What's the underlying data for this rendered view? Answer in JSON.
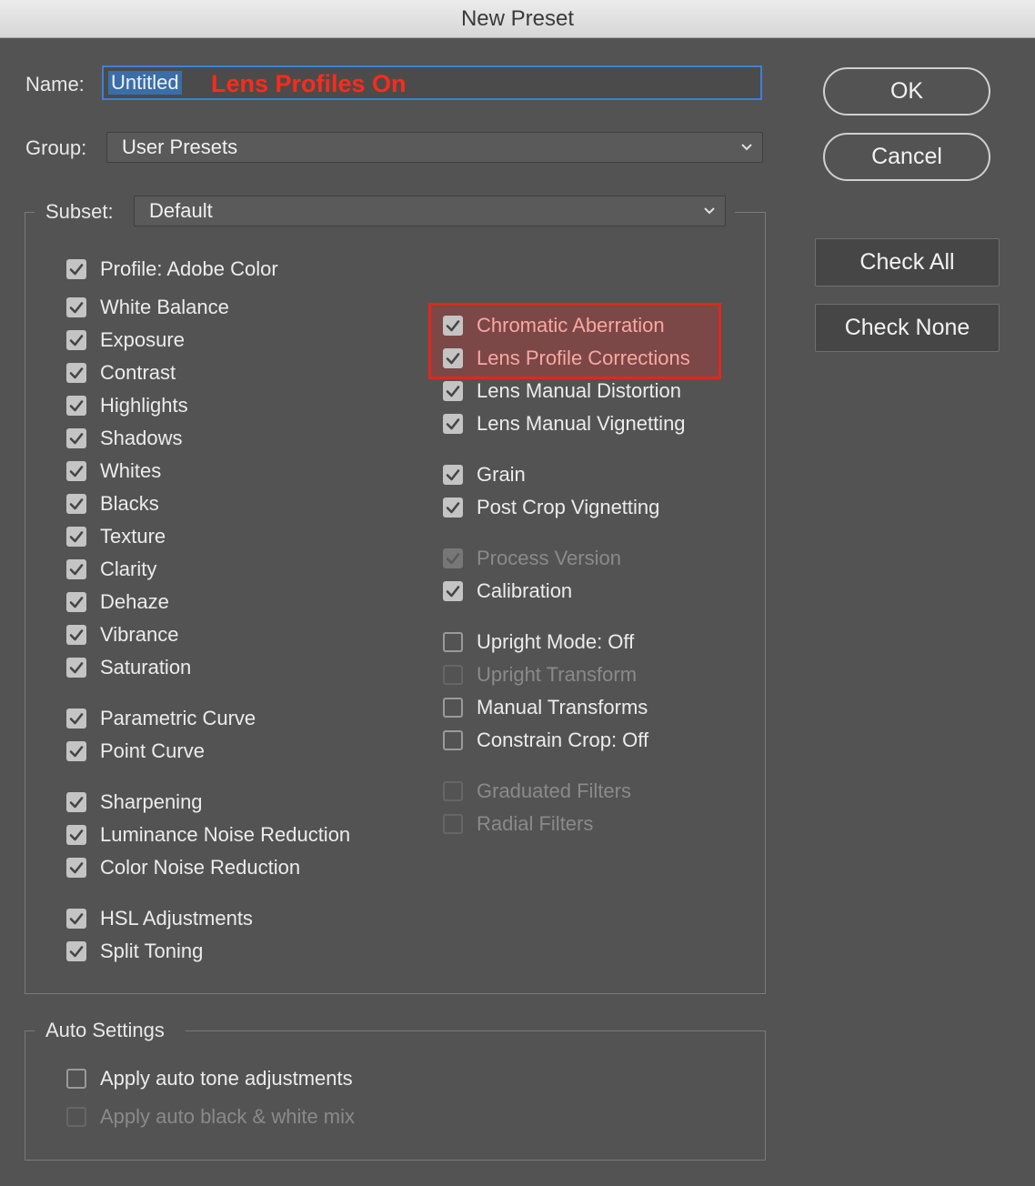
{
  "window": {
    "title": "New Preset"
  },
  "name_field": {
    "label": "Name:",
    "selected_value": "Untitled",
    "annotation": "Lens Profiles On"
  },
  "group": {
    "label": "Group:",
    "value": "User Presets"
  },
  "subset": {
    "label": "Subset:",
    "value": "Default"
  },
  "buttons": {
    "ok": "OK",
    "cancel": "Cancel",
    "check_all": "Check All",
    "check_none": "Check None"
  },
  "left_items": [
    {
      "label": "Profile: Adobe Color",
      "checked": true,
      "enabled": true
    },
    {
      "label": "White Balance",
      "checked": true,
      "enabled": true
    },
    {
      "label": "Exposure",
      "checked": true,
      "enabled": true
    },
    {
      "label": "Contrast",
      "checked": true,
      "enabled": true
    },
    {
      "label": "Highlights",
      "checked": true,
      "enabled": true
    },
    {
      "label": "Shadows",
      "checked": true,
      "enabled": true
    },
    {
      "label": "Whites",
      "checked": true,
      "enabled": true
    },
    {
      "label": "Blacks",
      "checked": true,
      "enabled": true
    },
    {
      "label": "Texture",
      "checked": true,
      "enabled": true
    },
    {
      "label": "Clarity",
      "checked": true,
      "enabled": true
    },
    {
      "label": "Dehaze",
      "checked": true,
      "enabled": true
    },
    {
      "label": "Vibrance",
      "checked": true,
      "enabled": true
    },
    {
      "label": "Saturation",
      "checked": true,
      "enabled": true
    },
    {
      "label": "Parametric Curve",
      "checked": true,
      "enabled": true
    },
    {
      "label": "Point Curve",
      "checked": true,
      "enabled": true
    },
    {
      "label": "Sharpening",
      "checked": true,
      "enabled": true
    },
    {
      "label": "Luminance Noise Reduction",
      "checked": true,
      "enabled": true
    },
    {
      "label": "Color Noise Reduction",
      "checked": true,
      "enabled": true
    },
    {
      "label": "HSL Adjustments",
      "checked": true,
      "enabled": true
    },
    {
      "label": "Split Toning",
      "checked": true,
      "enabled": true
    }
  ],
  "right_items": [
    {
      "label": "Chromatic Aberration",
      "checked": true,
      "enabled": true,
      "highlighted": true
    },
    {
      "label": "Lens Profile Corrections",
      "checked": true,
      "enabled": true,
      "highlighted": true
    },
    {
      "label": "Lens Manual Distortion",
      "checked": true,
      "enabled": true
    },
    {
      "label": "Lens Manual Vignetting",
      "checked": true,
      "enabled": true
    },
    {
      "label": "Grain",
      "checked": true,
      "enabled": true
    },
    {
      "label": "Post Crop Vignetting",
      "checked": true,
      "enabled": true
    },
    {
      "label": "Process Version",
      "checked": true,
      "enabled": false
    },
    {
      "label": "Calibration",
      "checked": true,
      "enabled": true
    },
    {
      "label": "Upright Mode: Off",
      "checked": false,
      "enabled": true
    },
    {
      "label": "Upright Transform",
      "checked": false,
      "enabled": false
    },
    {
      "label": "Manual Transforms",
      "checked": false,
      "enabled": true
    },
    {
      "label": "Constrain Crop: Off",
      "checked": false,
      "enabled": true
    },
    {
      "label": "Graduated Filters",
      "checked": false,
      "enabled": false
    },
    {
      "label": "Radial Filters",
      "checked": false,
      "enabled": false
    }
  ],
  "auto_settings": {
    "title": "Auto Settings",
    "items": [
      {
        "label": "Apply auto tone adjustments",
        "checked": false,
        "enabled": true
      },
      {
        "label": "Apply auto black & white mix",
        "checked": false,
        "enabled": false
      }
    ]
  },
  "colors": {
    "annotation_red": "#ff2a1a",
    "focus_blue": "#3d80d6",
    "highlight_border": "#e0281c"
  }
}
